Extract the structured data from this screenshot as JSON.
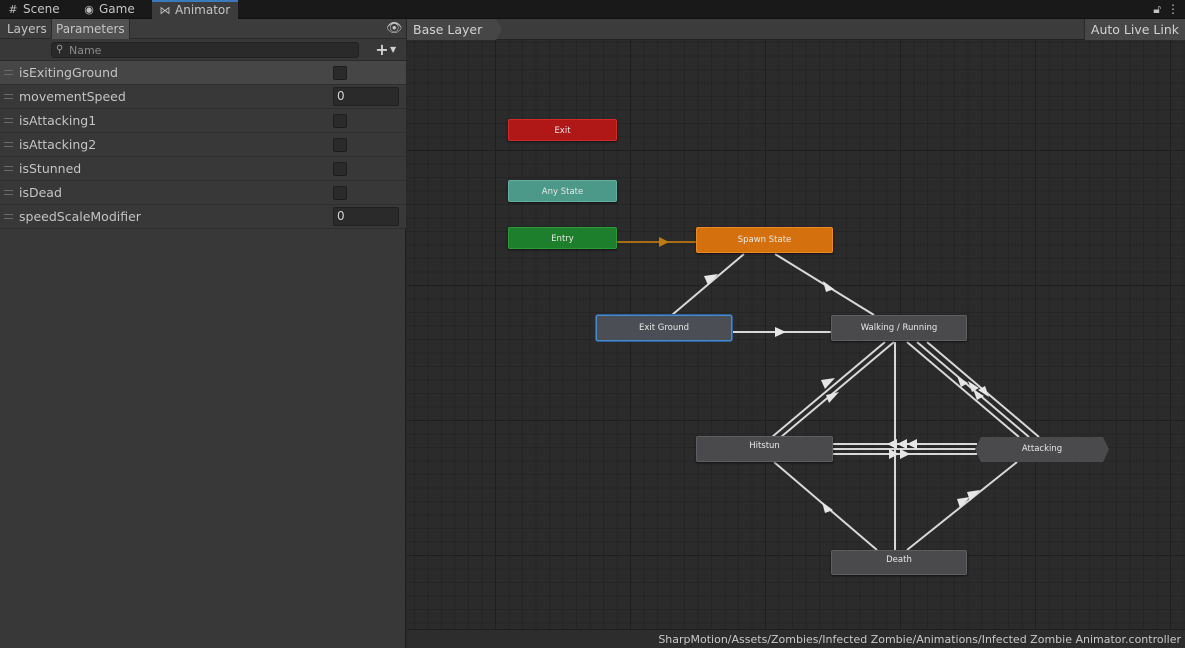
{
  "tabs": [
    {
      "label": "Scene",
      "icon": "grid-icon"
    },
    {
      "label": "Game",
      "icon": "gamepad-icon"
    },
    {
      "label": "Animator",
      "icon": "animator-icon"
    }
  ],
  "left_panel": {
    "layers_tab": "Layers",
    "parameters_tab": "Parameters",
    "search_placeholder": "Name",
    "parameters": [
      {
        "name": "isExitingGround",
        "type": "bool"
      },
      {
        "name": "movementSpeed",
        "type": "float",
        "value": "0"
      },
      {
        "name": "isAttacking1",
        "type": "bool"
      },
      {
        "name": "isAttacking2",
        "type": "bool"
      },
      {
        "name": "isStunned",
        "type": "bool"
      },
      {
        "name": "isDead",
        "type": "bool"
      },
      {
        "name": "speedScaleModifier",
        "type": "float",
        "value": "0"
      }
    ]
  },
  "graph": {
    "breadcrumb": "Base Layer",
    "auto_live_link": "Auto Live Link",
    "states": {
      "exit": "Exit",
      "any_state": "Any State",
      "entry": "Entry",
      "spawn": "Spawn State",
      "exit_ground": "Exit Ground",
      "walking": "Walking / Running",
      "hitstun": "Hitstun",
      "attacking": "Attacking",
      "death": "Death"
    }
  },
  "status": {
    "path": "SharpMotion/Assets/Zombies/Infected Zombie/Animations/Infected Zombie Animator.controller"
  },
  "colors": {
    "accent": "#3a79bb",
    "exit_node": "#b01818",
    "any_state_node": "#4c9889",
    "entry_node": "#1d7f2c",
    "default_state_node": "#d5700f"
  }
}
